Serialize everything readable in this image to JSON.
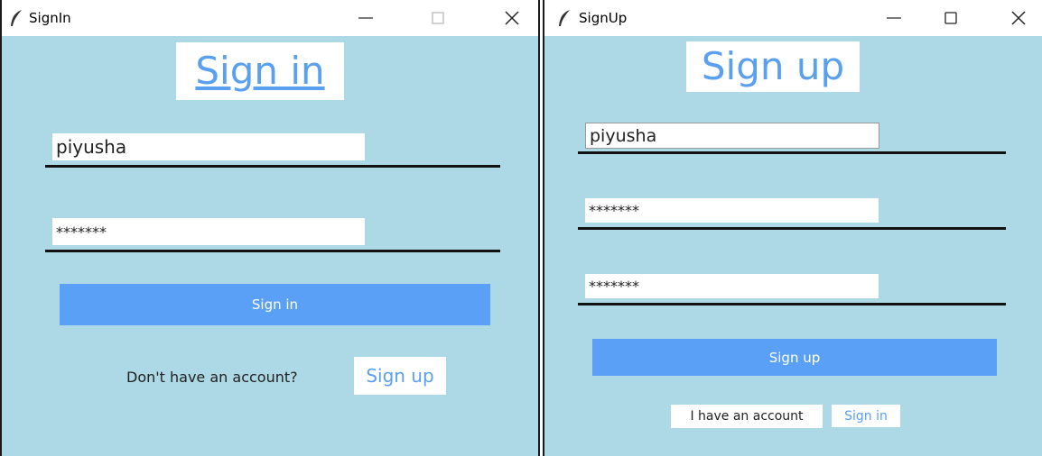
{
  "signin_window": {
    "title": "SignIn",
    "icon": "feather-icon",
    "heading": "Sign in",
    "username_value": "piyusha",
    "password_value": "*******",
    "button_label": "Sign in",
    "prompt_text": "Don't have an account?",
    "link_label": "Sign up"
  },
  "signup_window": {
    "title": "SignUp",
    "icon": "feather-icon",
    "heading": "Sign up",
    "username_value": "piyusha",
    "password_value": "*******",
    "confirm_password_value": "*******",
    "button_label": "Sign up",
    "prompt_text": "I have an account",
    "link_label": "Sign in"
  },
  "colors": {
    "background": "#add8e6",
    "accent": "#5aa0f7",
    "link": "#5aa0f0"
  }
}
